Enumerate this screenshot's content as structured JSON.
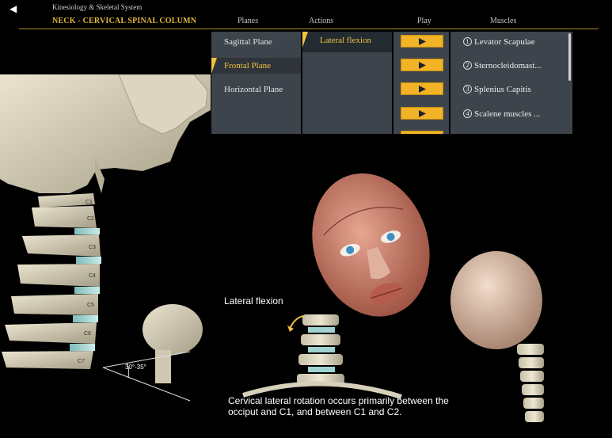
{
  "header": {
    "back_symbol": "◀",
    "app_title": "Kinesiology & Skeletal System",
    "section_title": "NECK - CERVICAL SPINAL COLUMN",
    "columns": {
      "planes": "Planes",
      "actions": "Actions",
      "play": "Play",
      "muscles": "Muscles"
    }
  },
  "planes": [
    {
      "label": "Sagittal Plane",
      "selected": false
    },
    {
      "label": "Frontal Plane",
      "selected": true
    },
    {
      "label": "Horizontal Plane",
      "selected": false
    }
  ],
  "actions": [
    {
      "label": "Lateral flexion",
      "selected": true
    }
  ],
  "play_buttons_count": 4,
  "muscles": [
    {
      "num": "1",
      "label": "Levator Scapulae"
    },
    {
      "num": "2",
      "label": "Sternocleidomast..."
    },
    {
      "num": "3",
      "label": "Splenius Capitis"
    },
    {
      "num": "4",
      "label": "Scalene muscles ..."
    }
  ],
  "left_view": {
    "vertebrae": [
      "C1",
      "C2",
      "C3",
      "C4",
      "C5",
      "C6",
      "C7"
    ],
    "angle_label": "30°-35°"
  },
  "right_view": {
    "motion_label": "Lateral flexion",
    "caption": "Cervical lateral rotation occurs primarily between the occiput and C1, and between C1 and C2."
  },
  "colors": {
    "accent": "#f0c341",
    "menu_bg": "#3d444c",
    "play_button": "#f2b326",
    "bone": "#d9d3be",
    "disc": "#a9d6d4",
    "muscle": "#c9715f"
  }
}
